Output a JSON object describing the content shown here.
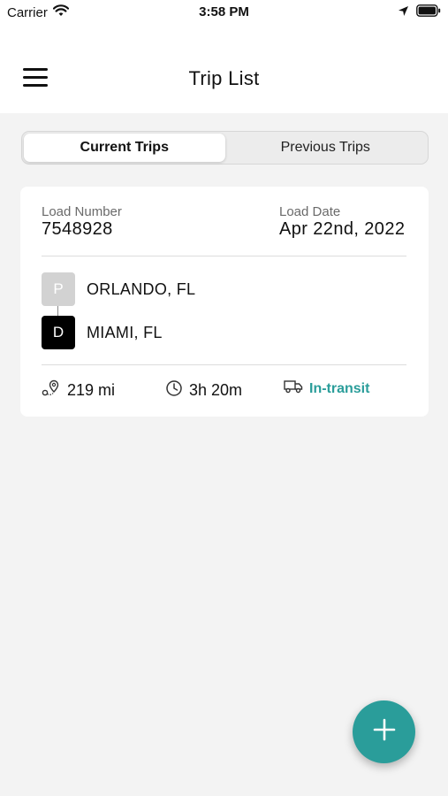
{
  "status_bar": {
    "carrier": "Carrier",
    "time": "3:58 PM",
    "icons": [
      "wifi-icon",
      "location-arrow-icon",
      "battery-icon"
    ]
  },
  "header": {
    "title": "Trip List",
    "menu_icon": "hamburger-menu-icon"
  },
  "tabs": [
    {
      "label": "Current Trips",
      "active": true
    },
    {
      "label": "Previous Trips",
      "active": false
    }
  ],
  "trip": {
    "load_number_label": "Load Number",
    "load_number": "7548928",
    "load_date_label": "Load Date",
    "load_date": "Apr 22nd, 2022",
    "pickup": {
      "badge": "P",
      "city": "ORLANDO, FL"
    },
    "dropoff": {
      "badge": "D",
      "city": "MIAMI, FL"
    },
    "distance": "219 mi",
    "duration": "3h 20m",
    "status": "In-transit"
  },
  "fab": {
    "icon": "plus-icon"
  },
  "colors": {
    "accent": "#2a9d9a",
    "background": "#f3f3f3",
    "card": "#ffffff",
    "pickup_badge": "#d2d2d2",
    "dropoff_badge": "#000000"
  }
}
